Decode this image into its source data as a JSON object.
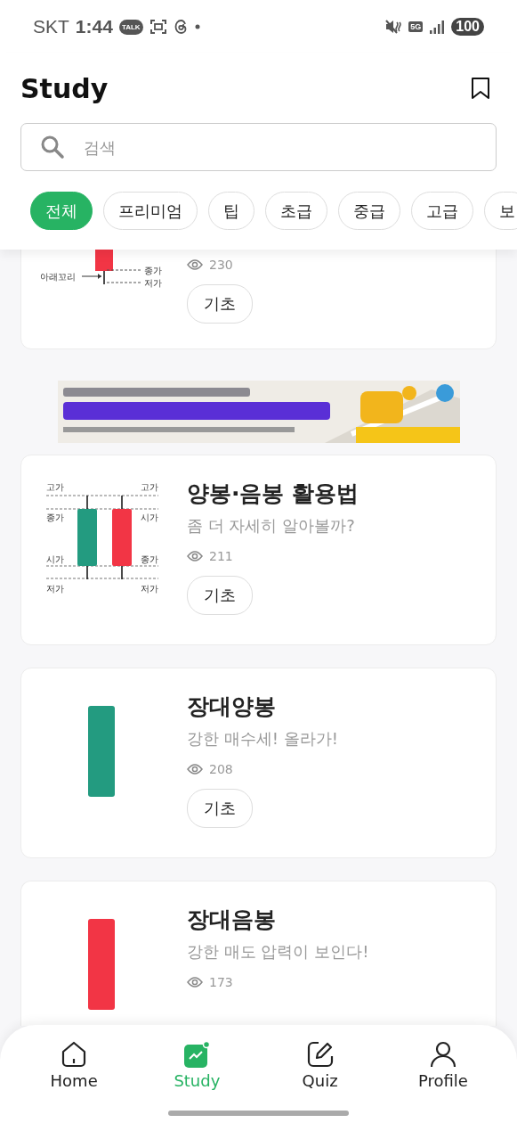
{
  "status_bar": {
    "carrier": "SKT",
    "time": "1:44",
    "talk_badge": "TALK",
    "network": "5G",
    "battery": "100"
  },
  "header": {
    "title": "Study"
  },
  "search": {
    "placeholder": "검색"
  },
  "filters": [
    {
      "label": "전체",
      "selected": true
    },
    {
      "label": "프리미엄",
      "selected": false
    },
    {
      "label": "팁",
      "selected": false
    },
    {
      "label": "초급",
      "selected": false
    },
    {
      "label": "중급",
      "selected": false
    },
    {
      "label": "고급",
      "selected": false
    },
    {
      "label": "보",
      "selected": false
    }
  ],
  "items": [
    {
      "kind": "lower-wick",
      "labels": [
        "아래꼬리",
        "종가",
        "저가"
      ],
      "views": "230",
      "tag": "기초"
    },
    {
      "kind": "ad"
    },
    {
      "kind": "bull-bear",
      "labels": [
        "고가",
        "종가",
        "시가",
        "저가",
        "고가",
        "시가",
        "종가",
        "저가"
      ],
      "title": "양봉·음봉 활용법",
      "subtitle": "좀 더 자세히 알아볼까?",
      "views": "211",
      "tag": "기초"
    },
    {
      "kind": "bull-bar",
      "title": "장대양봉",
      "subtitle": "강한 매수세! 올라가!",
      "views": "208",
      "tag": "기초"
    },
    {
      "kind": "bear-bar",
      "title": "장대음봉",
      "subtitle": "강한 매도 압력이 보인다!",
      "views": "173"
    }
  ],
  "nav": [
    {
      "label": "Home",
      "selected": false
    },
    {
      "label": "Study",
      "selected": true
    },
    {
      "label": "Quiz",
      "selected": false
    },
    {
      "label": "Profile",
      "selected": false
    }
  ]
}
